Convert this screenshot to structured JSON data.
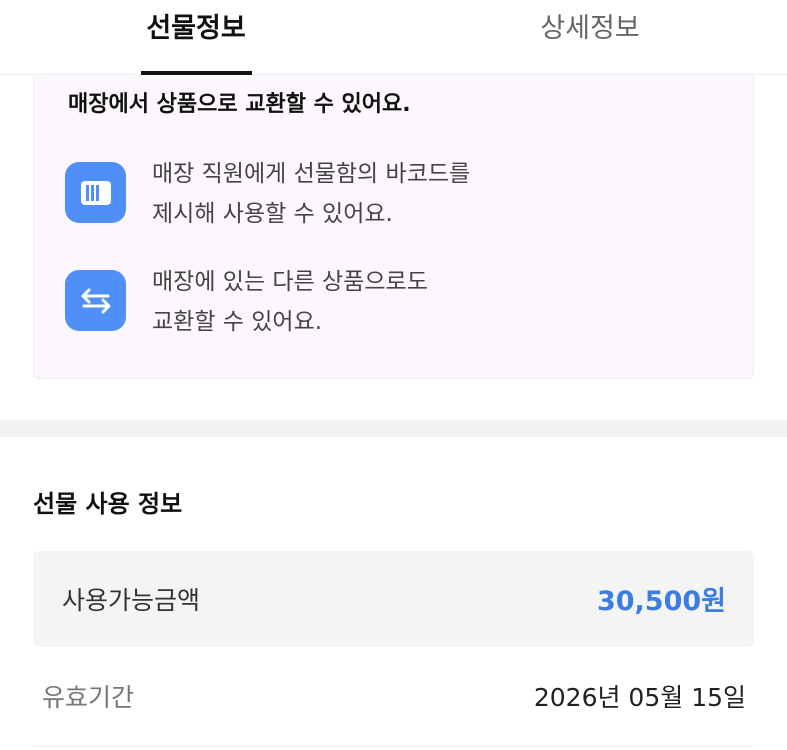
{
  "tabs": [
    {
      "label": "선물정보",
      "active": true
    },
    {
      "label": "상세정보",
      "active": false
    }
  ],
  "info_card": {
    "title": "매장에서 상품으로 교환할 수 있어요.",
    "items": [
      {
        "icon": "barcode-icon",
        "line1": "매장 직원에게 선물함의 바코드를",
        "line2": "제시해 사용할 수 있어요."
      },
      {
        "icon": "exchange-arrows-icon",
        "line1": "매장에 있는 다른 상품으로도",
        "line2": "교환할 수 있어요."
      }
    ]
  },
  "usage_info": {
    "title": "선물 사용 정보",
    "available_amount_label": "사용가능금액",
    "available_amount_value": "30,500원",
    "expiry_label": "유효기간",
    "expiry_value": "2026년 05월 15일"
  },
  "colors": {
    "accent": "#3b7de1",
    "icon_bg": "#4f8ff7",
    "card_bg": "#fcf7fc"
  }
}
